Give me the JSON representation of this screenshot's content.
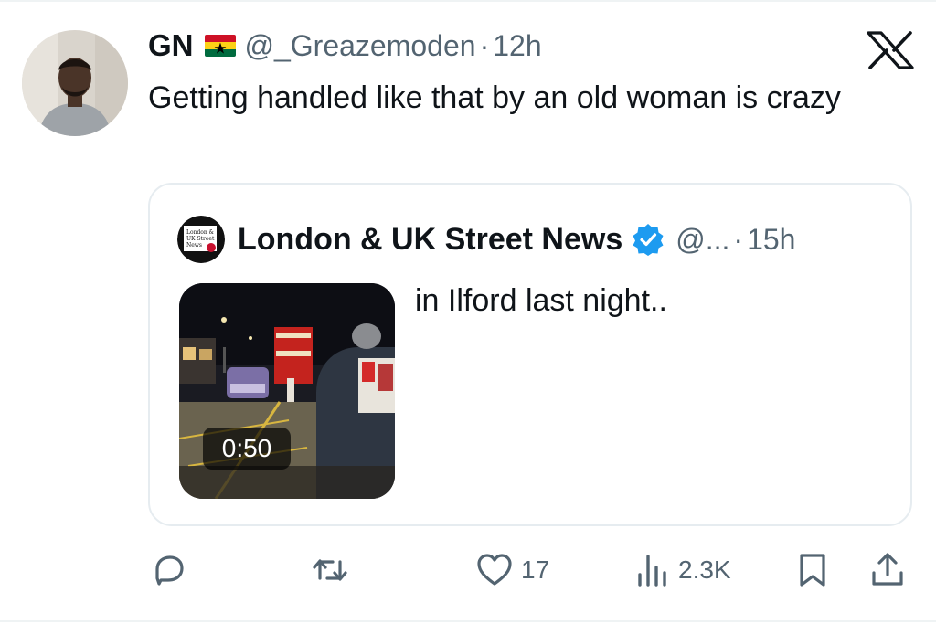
{
  "tweet": {
    "display_name": "GN",
    "flag_icon": "ghana-flag-icon",
    "handle": "@_Greazemoden",
    "separator": "·",
    "time": "12h",
    "text": "Getting handled like that by an old woman is crazy",
    "avatar_icon": "user-avatar"
  },
  "brand": {
    "logo_icon": "x-logo-icon"
  },
  "quoted": {
    "display_name": "London & UK Street News",
    "verified_icon": "verified-badge-icon",
    "handle": "@...",
    "separator": "·",
    "time": "15h",
    "text": "in Ilford last night..",
    "avatar_text": "London & UK Street News",
    "video_duration": "0:50"
  },
  "actions": {
    "reply_icon": "reply-icon",
    "retweet_icon": "retweet-icon",
    "like_icon": "heart-icon",
    "like_count": "17",
    "views_icon": "views-icon",
    "views_count": "2.3K",
    "bookmark_icon": "bookmark-icon",
    "share_icon": "share-icon"
  },
  "colors": {
    "text_primary": "#0f1419",
    "text_secondary": "#536471",
    "verified_blue": "#1d9bf0",
    "border": "#e6ecf0"
  }
}
